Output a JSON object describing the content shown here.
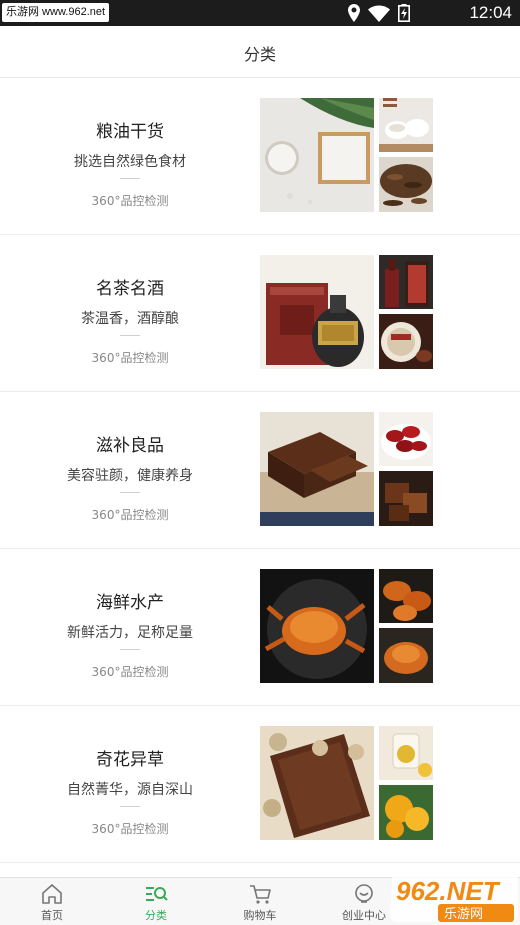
{
  "status_bar": {
    "watermark": "乐游网 www.962.net",
    "time": "12:04"
  },
  "header": {
    "title": "分类"
  },
  "categories": [
    {
      "title": "粮油干货",
      "subtitle": "挑选自然绿色食材",
      "check": "360°品控检测"
    },
    {
      "title": "名茶名酒",
      "subtitle": "茶温香，酒醇酿",
      "check": "360°品控检测"
    },
    {
      "title": "滋补良品",
      "subtitle": "美容驻颜，健康养身",
      "check": "360°品控检测"
    },
    {
      "title": "海鲜水产",
      "subtitle": "新鲜活力，足称足量",
      "check": "360°品控检测"
    },
    {
      "title": "奇花异草",
      "subtitle": "自然菁华，源自深山",
      "check": "360°品控检测"
    }
  ],
  "bottom_nav": [
    {
      "label": "首页",
      "icon": "home-icon",
      "active": false
    },
    {
      "label": "分类",
      "icon": "category-search-icon",
      "active": true
    },
    {
      "label": "购物车",
      "icon": "cart-icon",
      "active": false
    },
    {
      "label": "创业中心",
      "icon": "startup-center-icon",
      "active": false
    }
  ],
  "watermark_logo": {
    "brand": "962.NET",
    "site": "乐游网"
  },
  "colors": {
    "accent": "#3aa95c",
    "status_bar": "#1c1c1c"
  }
}
